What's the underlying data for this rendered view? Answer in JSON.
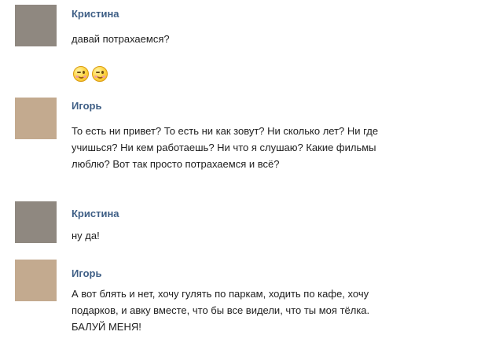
{
  "messages": [
    {
      "author": "Кристина",
      "lines": [
        "давай потрахаемся?"
      ],
      "emoji": [
        "wink-smile-icon",
        "wink-smile-icon"
      ]
    },
    {
      "author": "Игорь",
      "lines": [
        "То есть ни привет? То есть ни как зовут? Ни сколько лет? Ни где",
        "учишься? Ни кем работаешь? Ни что я слушаю? Какие фильмы",
        "люблю? Вот так просто потрахаемся и всё?"
      ]
    },
    {
      "author": "Кристина",
      "lines": [
        "ну да!"
      ]
    },
    {
      "author": "Игорь",
      "lines": [
        "А вот блять и нет, хочу гулять по паркам, ходить по кафе, хочу",
        "подарков, и авку вместе, что бы все видели, что ты моя тёлка.",
        "БАЛУЙ МЕНЯ!"
      ]
    }
  ]
}
